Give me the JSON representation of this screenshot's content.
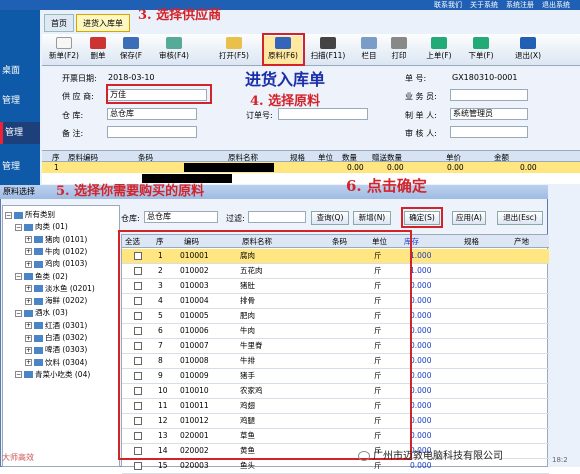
{
  "top_links": [
    "联系我们",
    "关于系统",
    "系统注册",
    "退出系统"
  ],
  "nav": [
    "桌面",
    "管理",
    "管理",
    "管理"
  ],
  "tabs": [
    "首页",
    "进货入库单"
  ],
  "toolbar": [
    "新单(F2)",
    "删单",
    "保存(F",
    "审核(F4)",
    "打开(F5)",
    "原料(F6)",
    "扫描(F11)",
    "栏目",
    "打印",
    "上单(F)",
    "下单(F)",
    "退出(X)"
  ],
  "form": {
    "title": "进货入库单",
    "date_label": "开票日期:",
    "date": "2018-03-10",
    "supplier_label": "供 应 商:",
    "supplier": "万佳",
    "warehouse_label": "仓    库:",
    "warehouse": "总仓库",
    "note_label": "备    注:",
    "note": "",
    "order_label": "订单号:",
    "order": "",
    "no_label": "单    号:",
    "no": "GX180310-0001",
    "staff_label": "业 务 员:",
    "staff": "",
    "maker_label": "制 单 人:",
    "maker": "系统管理员",
    "auditor_label": "审 核 人:",
    "auditor": ""
  },
  "grid": {
    "headers": [
      "序",
      "原料编码",
      "条码",
      "原料名称",
      "规格",
      "单位",
      "数量",
      "赠送数量",
      "单价",
      "金额"
    ],
    "row": {
      "idx": "1",
      "qty": "0.00",
      "gift": "0.00",
      "price": "0.00",
      "amount": "0.00"
    }
  },
  "annotations": {
    "a3": "3. 选择供应商",
    "a4": "4. 选择原料",
    "a5": "5. 选择你需要购买的原料",
    "a6": "6. 点击确定"
  },
  "dialog": {
    "title": "原料选择",
    "warehouse_label": "仓库:",
    "warehouse": "总仓库",
    "filter_label": "过滤:",
    "buttons": [
      "查询(Q)",
      "新增(N)",
      "确定(S)",
      "应用(A)",
      "退出(Esc)"
    ],
    "tree": [
      {
        "t": "所有类别",
        "lv": 0
      },
      {
        "t": "肉类 (01)",
        "lv": 1
      },
      {
        "t": "猪肉 (0101)",
        "lv": 2
      },
      {
        "t": "牛肉 (0102)",
        "lv": 2
      },
      {
        "t": "鸡肉 (0103)",
        "lv": 2
      },
      {
        "t": "鱼类 (02)",
        "lv": 1
      },
      {
        "t": "淡水鱼 (0201)",
        "lv": 2
      },
      {
        "t": "海鲜 (0202)",
        "lv": 2
      },
      {
        "t": "酒水 (03)",
        "lv": 1
      },
      {
        "t": "红酒 (0301)",
        "lv": 2
      },
      {
        "t": "白酒 (0302)",
        "lv": 2
      },
      {
        "t": "啤酒 (0303)",
        "lv": 2
      },
      {
        "t": "饮料 (0304)",
        "lv": 2
      },
      {
        "t": "青菜小吃类 (04)",
        "lv": 1
      }
    ],
    "table_headers": [
      "全选",
      "序",
      "编码",
      "原料名称",
      "条码",
      "单位",
      "库存",
      "规格",
      "产地"
    ],
    "rows": [
      {
        "n": "1",
        "code": "010001",
        "name": "腐肉",
        "unit": "斤",
        "stock": "1.000"
      },
      {
        "n": "2",
        "code": "010002",
        "name": "五花肉",
        "unit": "斤",
        "stock": "1.000"
      },
      {
        "n": "3",
        "code": "010003",
        "name": "猪肚",
        "unit": "斤",
        "stock": "0.000"
      },
      {
        "n": "4",
        "code": "010004",
        "name": "排骨",
        "unit": "斤",
        "stock": "0.000"
      },
      {
        "n": "5",
        "code": "010005",
        "name": "肥肉",
        "unit": "斤",
        "stock": "0.000"
      },
      {
        "n": "6",
        "code": "010006",
        "name": "牛肉",
        "unit": "斤",
        "stock": "0.000"
      },
      {
        "n": "7",
        "code": "010007",
        "name": "牛里脊",
        "unit": "斤",
        "stock": "0.000"
      },
      {
        "n": "8",
        "code": "010008",
        "name": "牛排",
        "unit": "斤",
        "stock": "0.000"
      },
      {
        "n": "9",
        "code": "010009",
        "name": "猪手",
        "unit": "斤",
        "stock": "0.000"
      },
      {
        "n": "10",
        "code": "010010",
        "name": "农家鸡",
        "unit": "斤",
        "stock": "0.000"
      },
      {
        "n": "11",
        "code": "010011",
        "name": "鸡翅",
        "unit": "斤",
        "stock": "0.000"
      },
      {
        "n": "12",
        "code": "010012",
        "name": "鸡腿",
        "unit": "斤",
        "stock": "0.000"
      },
      {
        "n": "13",
        "code": "020001",
        "name": "草鱼",
        "unit": "斤",
        "stock": "0.000"
      },
      {
        "n": "14",
        "code": "020002",
        "name": "黄鱼",
        "unit": "斤",
        "stock": "0.000"
      },
      {
        "n": "15",
        "code": "020003",
        "name": "鱼头",
        "unit": "斤",
        "stock": "0.000"
      }
    ]
  },
  "watermark": "广州市迈敦电脑科技有限公司",
  "watermark_left": "大师高效",
  "time": "18:2"
}
